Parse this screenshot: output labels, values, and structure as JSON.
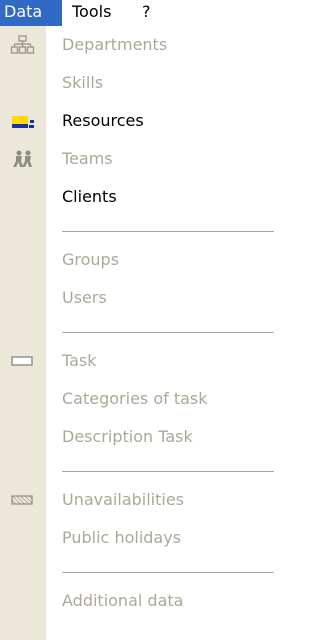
{
  "menubar": {
    "data_label": "Data",
    "tools_label": "Tools",
    "help_label": "?"
  },
  "menu": {
    "departments": "Departments",
    "skills": "Skills",
    "resources": "Resources",
    "teams": "Teams",
    "clients": "Clients",
    "groups": "Groups",
    "users": "Users",
    "task": "Task",
    "categories_of_task": "Categories of task",
    "description_task": "Description Task",
    "unavailabilities": "Unavailabilities",
    "public_holidays": "Public holidays",
    "additional_data": "Additional data"
  },
  "colors": {
    "menu_highlight": "#316ac5",
    "disabled_text": "#aca899",
    "gutter": "#ebe8da",
    "resources_icon_yellow": "#ffd800",
    "resources_icon_blue": "#1a2fb0"
  },
  "icons": {
    "departments": "org-chart-icon",
    "resources": "resources-icon",
    "teams": "team-people-icon",
    "task": "task-bar-icon",
    "unavailabilities": "hatched-block-icon"
  }
}
